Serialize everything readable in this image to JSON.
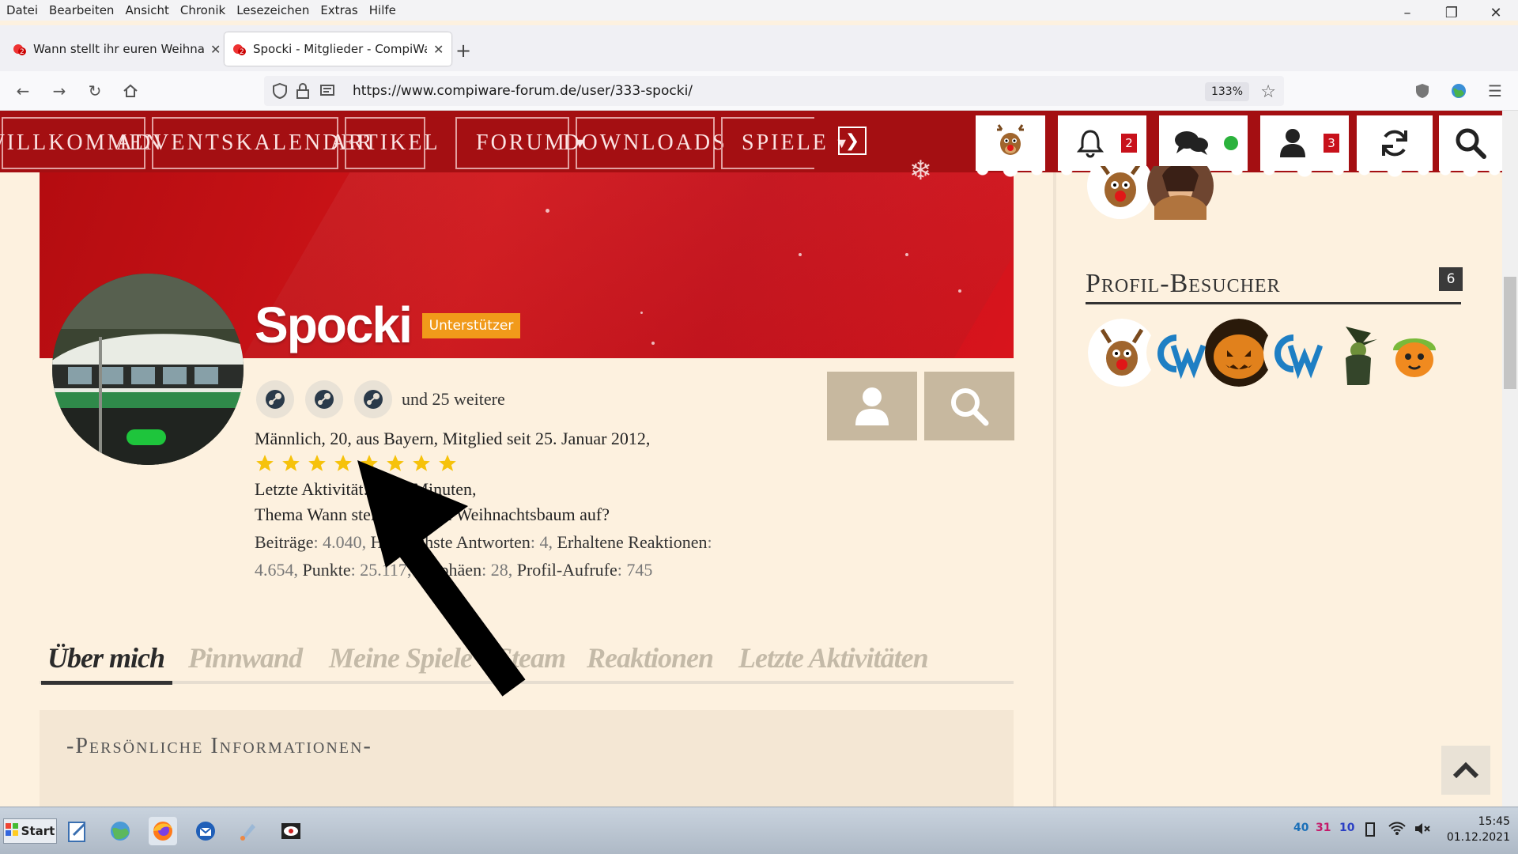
{
  "browser": {
    "menu": [
      "Datei",
      "Bearbeiten",
      "Ansicht",
      "Chronik",
      "Lesezeichen",
      "Extras",
      "Hilfe"
    ],
    "tabs": [
      {
        "title": "Wann stellt ihr euren Weihnacht"
      },
      {
        "title": "Spocki - Mitglieder - CompiWa"
      }
    ],
    "url": "https://www.compiware-forum.de/user/333-spocki/",
    "zoom": "133%"
  },
  "sitenav": {
    "items": [
      "Willkommen",
      "Adventskalender",
      "Artikel",
      "Forum",
      "Downloads",
      "Spiele"
    ],
    "notifications_count": "2",
    "user_count": "3"
  },
  "profile": {
    "username": "Spocki",
    "rank": "Unterstützer",
    "more_games": "und 25 weitere",
    "info_line": "Männlich, 20, aus Bayern, Mitglied seit 25. Januar 2012,",
    "rating_stars": 8,
    "last_activity_label": "Letzte Aktivität:",
    "last_activity_value": "vor 2 Minuten,",
    "thread_prefix": "Thema",
    "thread_title": "Wann stellt ihr euren Weihnachtsbaum auf?",
    "stats_line1": {
      "posts_label": "Beiträge",
      "posts": "4.040",
      "best_label": "Hilfreichste Antworten",
      "best": "4",
      "reactions_label": "Erhaltene Reaktionen"
    },
    "stats_line2": {
      "reactions": "4.654",
      "points_label": "Punkte",
      "points": "25.117",
      "trophies_label": "Trophäen",
      "trophies": "28",
      "views_label": "Profil-Aufrufe",
      "views": "745"
    }
  },
  "profile_tabs": [
    "Über mich",
    "Pinnwand",
    "Meine Spiele",
    "Steam",
    "Reaktionen",
    "Letzte Aktivitäten"
  ],
  "section_title": "-Persönliche Informationen-",
  "sidebar": {
    "visitors_title": "Profil-Besucher",
    "visitors_count": "6"
  },
  "taskbar": {
    "start": "Start",
    "time": "15:45",
    "date": "01.12.2021",
    "tray": [
      "40",
      "31",
      "10"
    ]
  },
  "colors": {
    "nav_red": "#a40f12",
    "banner_red": "#d2151a",
    "rank_orange": "#f19a1a",
    "star_gold": "#f6c20b",
    "online_green": "#1ec53c",
    "page_bg": "#fdf1df"
  }
}
